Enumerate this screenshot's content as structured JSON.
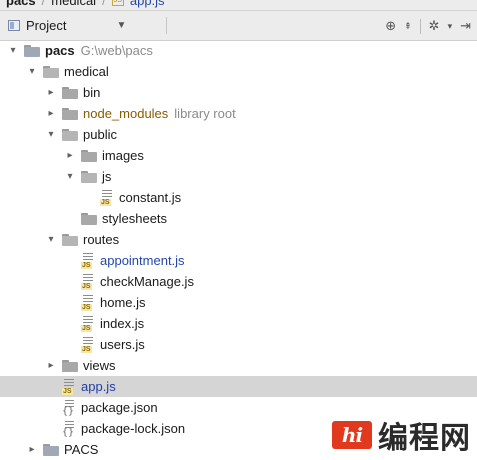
{
  "breadcrumb": {
    "root": "pacs",
    "folder": "medical",
    "file": "app.js",
    "badge": "JS"
  },
  "toolbar": {
    "view_label": "Project",
    "chevron": "▼",
    "icons": [
      "globe-icon",
      "collapse-icon",
      "gear-icon",
      "hide-icon"
    ]
  },
  "tree": {
    "root": {
      "name": "pacs",
      "path": "G:\\web\\pacs"
    },
    "medical": "medical",
    "bin": "bin",
    "node_modules": {
      "name": "node_modules",
      "note": "library root"
    },
    "public": "public",
    "images": "images",
    "js": "js",
    "constant": "constant.js",
    "stylesheets": "stylesheets",
    "routes": "routes",
    "appointment": "appointment.js",
    "checkManage": "checkManage.js",
    "home": "home.js",
    "index": "index.js",
    "users": "users.js",
    "views": "views",
    "app": "app.js",
    "package": "package.json",
    "package_lock": "package-lock.json",
    "pacs_module": "PACS"
  },
  "icon_badges": {
    "js": "JS",
    "json": "{}"
  },
  "watermark": {
    "logo": "hi",
    "text": "编程网"
  },
  "colors": {
    "selected_row": "#d5d5d5",
    "modified_text": "#2547a9",
    "excluded_text": "#8a5a00",
    "watermark_red": "#e0391e"
  }
}
